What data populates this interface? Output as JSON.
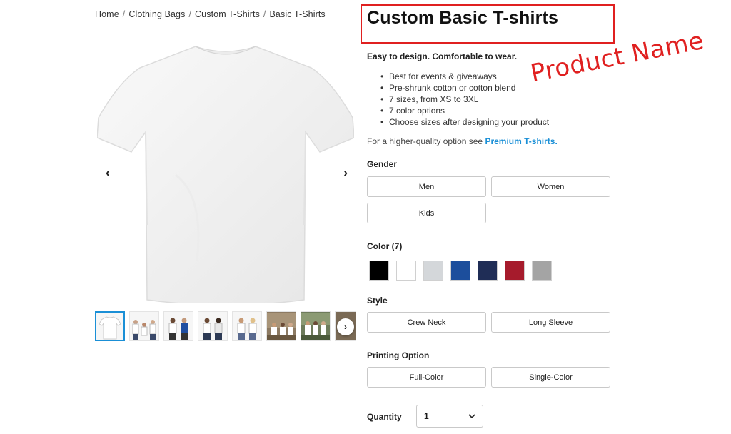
{
  "breadcrumb": {
    "items": [
      "Home",
      "Clothing Bags",
      "Custom T-Shirts",
      "Basic T-Shirts"
    ],
    "separator": "/"
  },
  "product": {
    "title": "Custom Basic T-shirts",
    "annotation": "Product Name",
    "tagline": "Easy to design. Comfortable to wear.",
    "features": [
      "Best for events & giveaways",
      "Pre-shrunk cotton or cotton blend",
      "7 sizes, from XS to 3XL",
      "7 color options",
      "Choose sizes after designing your product"
    ],
    "hq_text": "For a higher-quality option see ",
    "hq_link": "Premium T-shirts."
  },
  "gallery": {
    "prev_icon": "chevron-left-icon",
    "next_icon": "chevron-right-icon",
    "prev_glyph": "‹",
    "next_glyph": "›",
    "thumb_count": 8,
    "active_thumb": 1
  },
  "gender": {
    "label": "Gender",
    "options": [
      "Men",
      "Women",
      "Kids"
    ]
  },
  "color": {
    "label": "Color (7)",
    "swatches": [
      "#000000",
      "#ffffff",
      "#d4d7da",
      "#1c4e9c",
      "#1f2d56",
      "#a61b2c",
      "#a4a4a4"
    ]
  },
  "style": {
    "label": "Style",
    "options": [
      "Crew Neck",
      "Long Sleeve"
    ]
  },
  "printing": {
    "label": "Printing Option",
    "options": [
      "Full-Color",
      "Single-Color"
    ]
  },
  "quantity": {
    "label": "Quantity",
    "value": "1"
  },
  "colors": {
    "accent": "#1a8fd6",
    "annotation_red": "#e02020"
  }
}
